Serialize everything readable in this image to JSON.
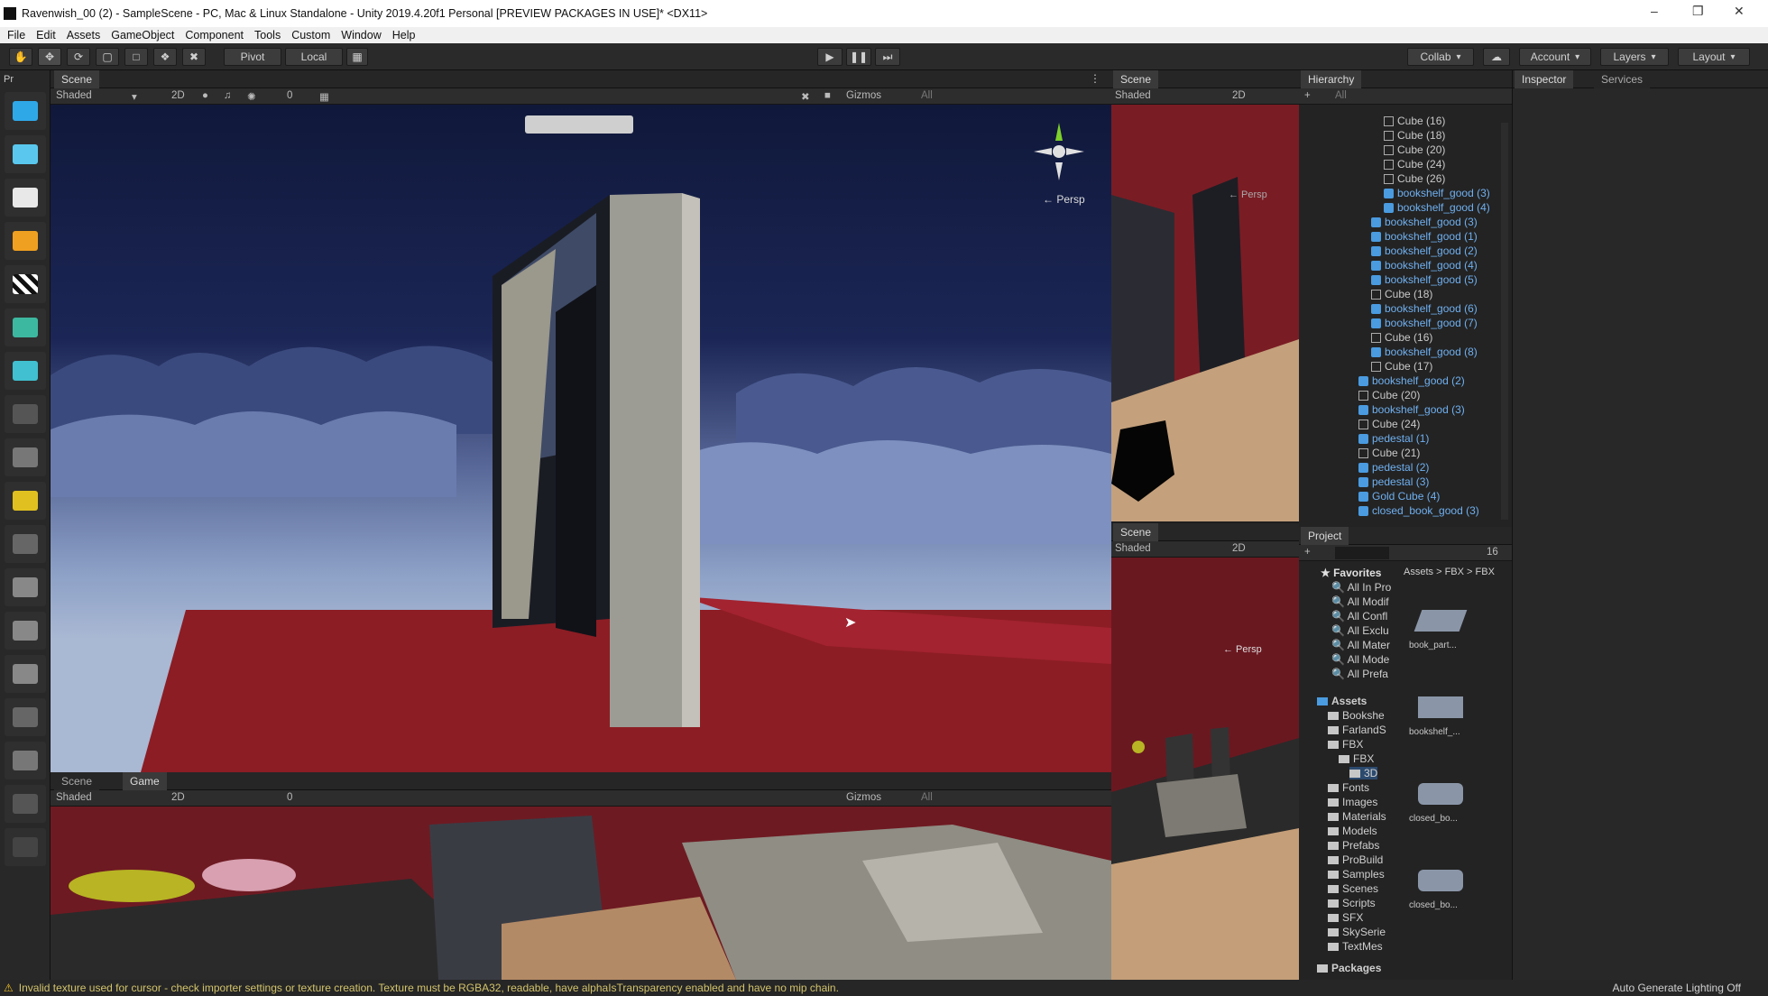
{
  "window": {
    "title": "Ravenwish_00 (2) - SampleScene - PC, Mac & Linux Standalone - Unity 2019.4.20f1 Personal [PREVIEW PACKAGES IN USE]* <DX11>"
  },
  "menu": [
    "File",
    "Edit",
    "Assets",
    "GameObject",
    "Component",
    "Tools",
    "Custom",
    "Window",
    "Help"
  ],
  "toolbar": {
    "pivot": "Pivot",
    "local": "Local",
    "collab": "Collab",
    "account": "Account",
    "layers": "Layers",
    "layout": "Layout"
  },
  "panels": {
    "left_tab": "Pr",
    "scene_tab": "Scene",
    "game_tab": "Game",
    "hierarchy_tab": "Hierarchy",
    "inspector_tab": "Inspector",
    "services_tab": "Services",
    "project_tab": "Project"
  },
  "scene_toolbar": {
    "shading": "Shaded",
    "mode2d": "2D",
    "gizmos": "Gizmos",
    "search_placeholder": "All",
    "hidden_count": "0",
    "persp": "← Persp"
  },
  "hierarchy": {
    "search_placeholder": "All",
    "items": [
      {
        "label": "Cube (16)",
        "type": "cube"
      },
      {
        "label": "Cube (18)",
        "type": "cube"
      },
      {
        "label": "Cube (20)",
        "type": "cube"
      },
      {
        "label": "Cube (24)",
        "type": "cube"
      },
      {
        "label": "Cube (26)",
        "type": "cube"
      },
      {
        "label": "bookshelf_good (3)",
        "type": "prefab"
      },
      {
        "label": "bookshelf_good (4)",
        "type": "prefab"
      },
      {
        "label": "bookshelf_good (3)",
        "type": "prefab"
      },
      {
        "label": "bookshelf_good (1)",
        "type": "prefab"
      },
      {
        "label": "bookshelf_good (2)",
        "type": "prefab"
      },
      {
        "label": "bookshelf_good (4)",
        "type": "prefab"
      },
      {
        "label": "bookshelf_good (5)",
        "type": "prefab"
      },
      {
        "label": "Cube (18)",
        "type": "cube"
      },
      {
        "label": "bookshelf_good (6)",
        "type": "prefab"
      },
      {
        "label": "bookshelf_good (7)",
        "type": "prefab"
      },
      {
        "label": "Cube (16)",
        "type": "cube"
      },
      {
        "label": "bookshelf_good (8)",
        "type": "prefab"
      },
      {
        "label": "Cube (17)",
        "type": "cube"
      },
      {
        "label": "bookshelf_good (2)",
        "type": "prefab"
      },
      {
        "label": "Cube (20)",
        "type": "cube"
      },
      {
        "label": "bookshelf_good (3)",
        "type": "prefab"
      },
      {
        "label": "Cube (24)",
        "type": "cube"
      },
      {
        "label": "pedestal (1)",
        "type": "prefab"
      },
      {
        "label": "Cube (21)",
        "type": "cube"
      },
      {
        "label": "pedestal (2)",
        "type": "prefab"
      },
      {
        "label": "pedestal (3)",
        "type": "prefab"
      },
      {
        "label": "Gold Cube (4)",
        "type": "prefab"
      },
      {
        "label": "closed_book_good (3)",
        "type": "prefab"
      }
    ]
  },
  "project": {
    "breadcrumb": [
      "Assets",
      "FBX",
      "FBX"
    ],
    "count": "16",
    "favorites_label": "Favorites",
    "favorites": [
      "All In Pro",
      "All Modif",
      "All Confl",
      "All Exclu",
      "All Mater",
      "All Mode",
      "All Prefa"
    ],
    "assets_label": "Assets",
    "folders": [
      "Bookshe",
      "FarlandS",
      "FBX",
      "FBX",
      "3D",
      "Fonts",
      "Images",
      "Materials",
      "Models",
      "Prefabs",
      "ProBuild",
      "Samples",
      "Scenes",
      "Scripts",
      "SFX",
      "SkySerie",
      "TextMes"
    ],
    "packages_label": "Packages",
    "asset_items": [
      "book_part...",
      "bookshelf_...",
      "closed_bo...",
      "closed_bo..."
    ]
  },
  "status": {
    "message": "Invalid texture used for cursor - check importer settings or texture creation. Texture must be RGBA32, readable, have alphaIsTransparency enabled and have no mip chain.",
    "right": "Auto Generate Lighting Off"
  },
  "colors": {
    "accent_blue": "#4a9be0",
    "floor_red": "#8c1d24",
    "sky_navy": "#141a3d"
  }
}
